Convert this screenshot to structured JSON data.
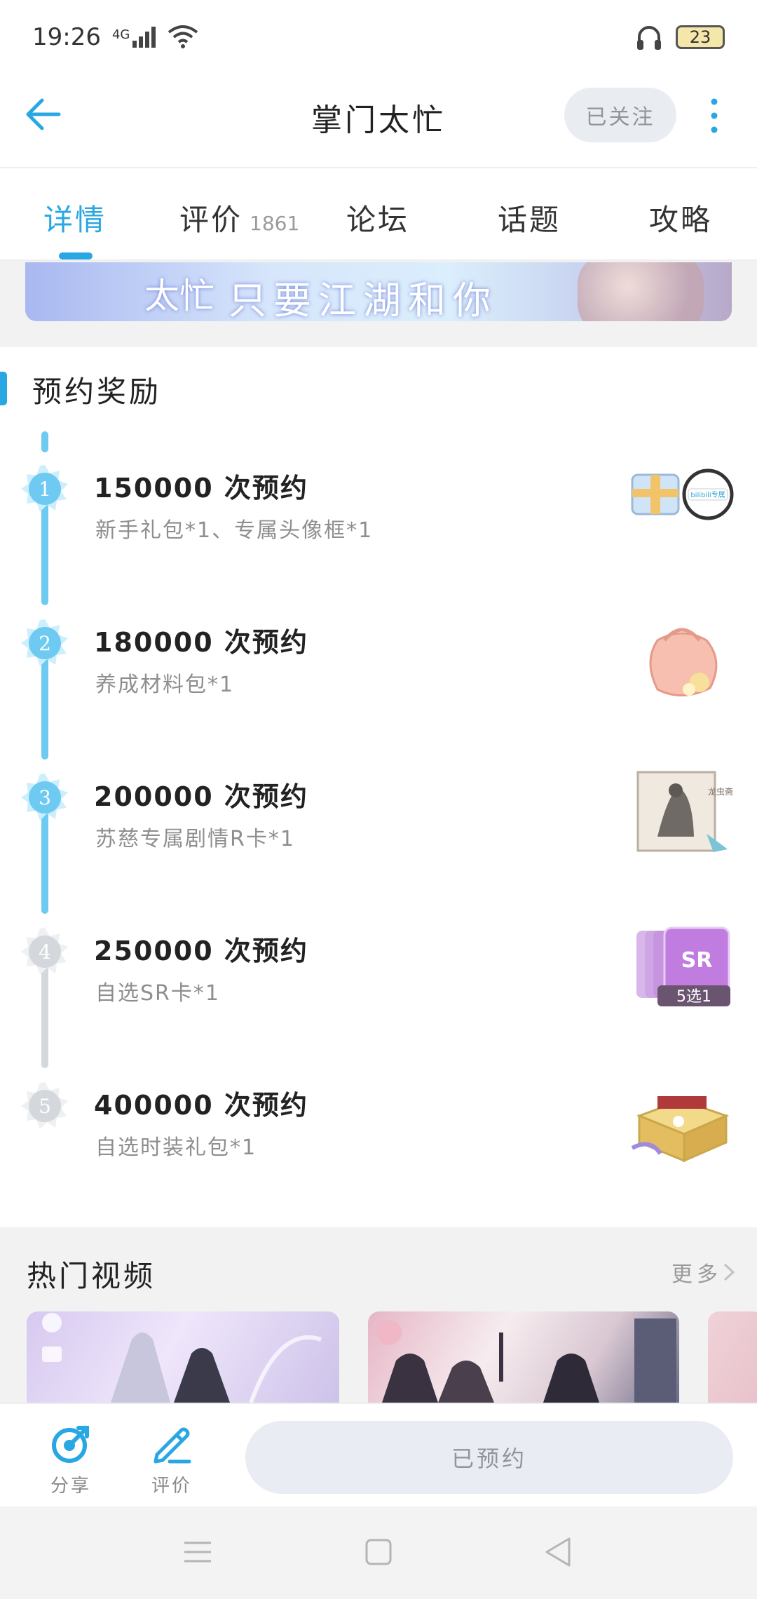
{
  "status_bar": {
    "time": "19:26",
    "network": "4G",
    "battery": "23"
  },
  "header": {
    "title": "掌门太忙",
    "follow_label": "已关注"
  },
  "tabs": [
    {
      "label": "详情",
      "count": ""
    },
    {
      "label": "评价",
      "count": "1861"
    },
    {
      "label": "论坛",
      "count": ""
    },
    {
      "label": "话题",
      "count": ""
    },
    {
      "label": "攻略",
      "count": ""
    }
  ],
  "banner": {
    "text": "只要江湖和你",
    "left_text": "太忙"
  },
  "rewards": {
    "title": "预约奖励",
    "items": [
      {
        "num": "1",
        "title": "150000 次预约",
        "desc": "新手礼包*1、专属头像框*1",
        "reached": true
      },
      {
        "num": "2",
        "title": "180000 次预约",
        "desc": "养成材料包*1",
        "reached": true
      },
      {
        "num": "3",
        "title": "200000 次预约",
        "desc": "苏慈专属剧情R卡*1",
        "reached": true
      },
      {
        "num": "4",
        "title": "250000 次预约",
        "desc": "自选SR卡*1",
        "reached": false
      },
      {
        "num": "5",
        "title": "400000 次预约",
        "desc": "自选时装礼包*1",
        "reached": false
      }
    ],
    "image_labels": {
      "frame": "bilibili专属",
      "card_pick": "5选1",
      "card_sr": "SR",
      "story": "龙虫斋"
    }
  },
  "videos": {
    "title": "热门视频",
    "more_label": "更多"
  },
  "bottom": {
    "share_label": "分享",
    "review_label": "评价",
    "reserved_label": "已预约"
  },
  "colors": {
    "accent": "#28a7e2",
    "timeline_on": "#6ecaf1",
    "timeline_off": "#d4d8dc"
  }
}
